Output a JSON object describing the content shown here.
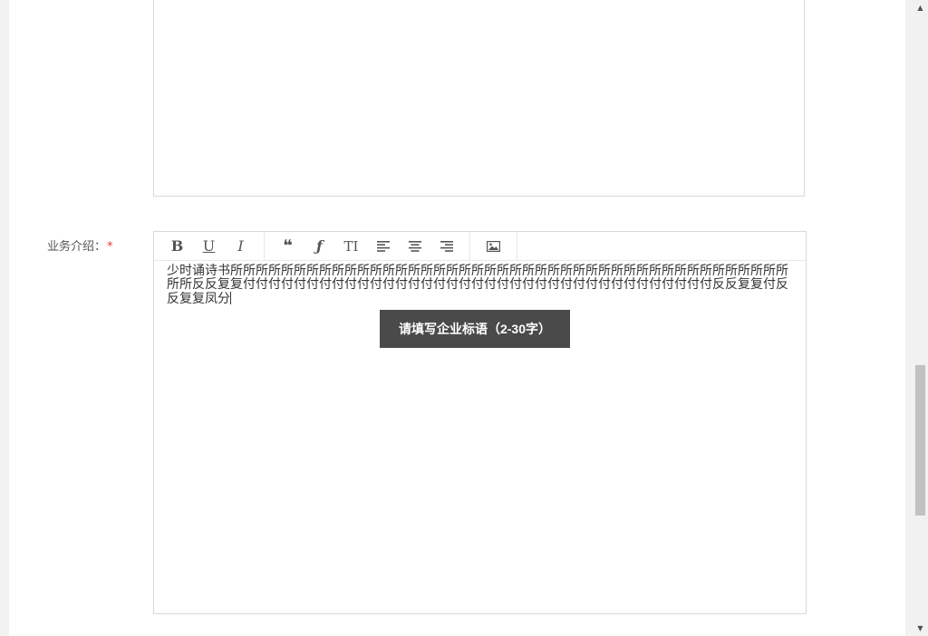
{
  "form": {
    "business_intro": {
      "label": "业务介绍：",
      "required_mark": "*",
      "content": "少时诵诗书所所所所所所所所所所所所所所所所所所所所所所所所所所所所所所所所所所所所所所所所所所所所所所反反复复付付付付付付付付付付付付付付付付付付付付付付付付付付付付付付付付付付付付付反反复复付反反复复凤分"
    }
  },
  "toolbar": {
    "bold": "B",
    "underline": "U",
    "italic": "I",
    "quote": "❝",
    "font": "ƒ",
    "font_size": "TI"
  },
  "tooltip": {
    "text": "请填写企业标语（2-30字）"
  }
}
